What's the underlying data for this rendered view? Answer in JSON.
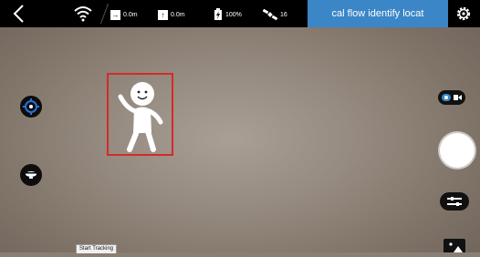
{
  "topbar": {
    "distance": "0.0m",
    "height": "0.0m",
    "battery": "100%",
    "satellites": "16",
    "mode_label": "cal flow identify locat"
  },
  "colors": {
    "topbar_bg": "#000000",
    "mode_tab_bg": "#3b86c7",
    "tracking_box": "#d52a2a",
    "target_icon_blue": "#2a6fd6"
  },
  "icons": {
    "back": "chevron-left-icon",
    "wifi": "wifi-icon",
    "distance": "arrow-right-icon",
    "height": "arrow-up-icon",
    "battery": "battery-icon",
    "satellites": "satellite-icon",
    "settings": "gear-icon",
    "target": "crosshair-icon",
    "drone": "drone-icon",
    "camera_switch": "camera-video-toggle-icon",
    "shutter": "shutter-icon",
    "adjust": "sliders-icon",
    "gallery": "gallery-icon"
  },
  "tracking": {
    "start_label": "Start Tracking"
  }
}
